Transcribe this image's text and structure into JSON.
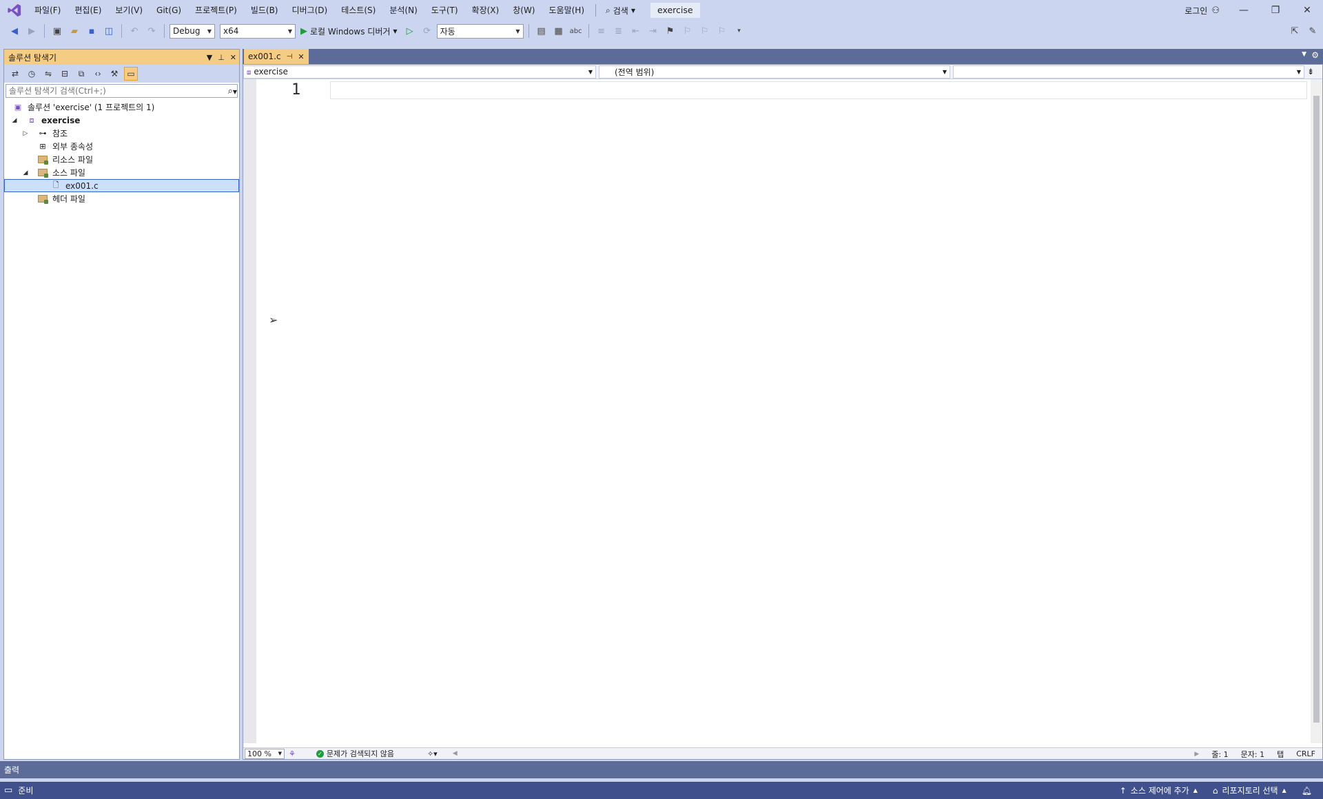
{
  "menu": {
    "items": [
      "파일(F)",
      "편집(E)",
      "보기(V)",
      "Git(G)",
      "프로젝트(P)",
      "빌드(B)",
      "디버그(D)",
      "테스트(S)",
      "분석(N)",
      "도구(T)",
      "확장(X)",
      "창(W)",
      "도움말(H)"
    ],
    "search_label": "검색",
    "solution_name": "exercise",
    "login_label": "로그인"
  },
  "toolbar": {
    "config": "Debug",
    "platform": "x64",
    "run_label": "로컬 Windows 디버거",
    "mode": "자동"
  },
  "solution_explorer": {
    "title": "솔루션 탐색기",
    "search_placeholder": "솔루션 탐색기 검색(Ctrl+;)",
    "tree": {
      "solution": "솔루션 'exercise' (1 프로젝트의 1)",
      "project": "exercise",
      "references": "참조",
      "external_deps": "외부 종속성",
      "resource_files": "리소스 파일",
      "source_files": "소스 파일",
      "source_file_item": "ex001.c",
      "header_files": "헤더 파일"
    }
  },
  "editor": {
    "tab_label": "ex001.c",
    "nav_project": "exercise",
    "nav_scope": "(전역 범위)",
    "nav_member": "",
    "line_number": "1",
    "zoom": "100 %",
    "issues": "문제가 검색되지 않음",
    "line_info": "줄: 1",
    "col_info": "문자: 1",
    "indent": "탭",
    "eol": "CRLF"
  },
  "output": {
    "title": "출력"
  },
  "statusbar": {
    "ready": "준비",
    "source_control": "소스 제어에 추가",
    "repo": "리포지토리 선택"
  },
  "colors": {
    "chrome": "#ccd5f0",
    "accent_tab": "#f5cc84",
    "statusbar": "#40508d",
    "tabstrip": "#5d6b99"
  }
}
